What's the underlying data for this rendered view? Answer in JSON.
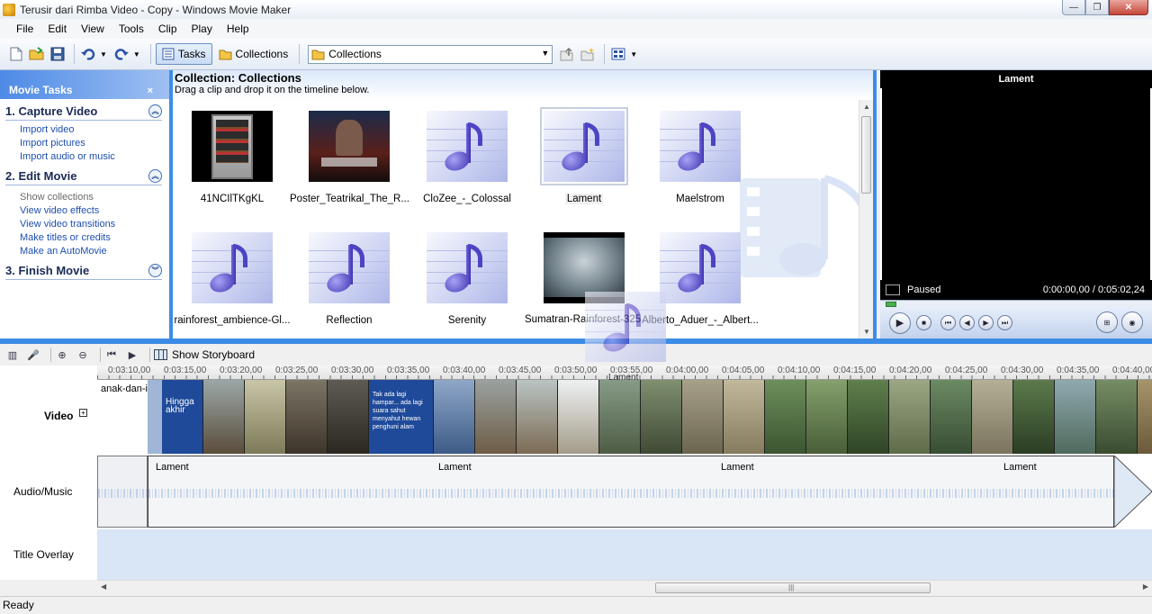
{
  "window": {
    "title": "Terusir dari Rimba Video - Copy - Windows Movie Maker",
    "min_glyph": "—",
    "max_glyph": "❐",
    "close_glyph": "✕"
  },
  "menu": [
    "File",
    "Edit",
    "View",
    "Tools",
    "Clip",
    "Play",
    "Help"
  ],
  "toolbar": {
    "tasks_label": "Tasks",
    "collections_label": "Collections",
    "collection_select_value": "Collections"
  },
  "tasks": {
    "header": "Movie Tasks",
    "close_glyph": "×",
    "sections": [
      {
        "title": "1. Capture Video",
        "toggle": "︽",
        "links": [
          "Import video",
          "Import pictures",
          "Import audio or music"
        ]
      },
      {
        "title": "2. Edit Movie",
        "toggle": "︽",
        "links": [
          "Show collections",
          "View video effects",
          "View video transitions",
          "Make titles or credits",
          "Make an AutoMovie"
        ]
      },
      {
        "title": "3. Finish Movie",
        "toggle": "︾",
        "links": []
      }
    ]
  },
  "collection": {
    "title": "Collection: Collections",
    "subtitle": "Drag a clip and drop it on the timeline below.",
    "items": [
      {
        "label": "41NCIlTKgKL",
        "kind": "image-fridge"
      },
      {
        "label": "Poster_Teatrikal_The_R...",
        "kind": "image-poster"
      },
      {
        "label": "CloZee_-_Colossal",
        "kind": "music"
      },
      {
        "label": "Lament",
        "kind": "music",
        "selected": true
      },
      {
        "label": "Maelstrom",
        "kind": "music"
      },
      {
        "label": "rainforest_ambience-Gl...",
        "kind": "music"
      },
      {
        "label": "Reflection",
        "kind": "music"
      },
      {
        "label": "Serenity",
        "kind": "music"
      },
      {
        "label": "Sumatran-Rainforest-325",
        "kind": "image-forest"
      },
      {
        "label": "Alberto_Aduer_-_Albert...",
        "kind": "music"
      }
    ]
  },
  "monitor": {
    "title": "Lament",
    "status": "Paused",
    "time": "0:00:00,00 / 0:05:02,24"
  },
  "timeline": {
    "toolbar": {
      "show_storyboard": "Show Storyboard"
    },
    "ruler_labels": [
      "0:03:10,00",
      "0:03:15,00",
      "0:03:20,00",
      "0:03:25,00",
      "0:03:30,00",
      "0:03:35,00",
      "0:03:40,00",
      "0:03:45,00",
      "0:03:50,00",
      "0:03:55,00",
      "0:04:00,00",
      "0:04:05,00",
      "0:04:10,00",
      "0:04:15,00",
      "0:04:20,00",
      "0:04:25,00",
      "0:04:30,00",
      "0:04:35,00",
      "0:04:40,00"
    ],
    "tracks": {
      "video": "Video",
      "audio": "Audio/Music",
      "overlay": "Title Overlay"
    },
    "video_clip_label": "anak-dan-i...",
    "frame_text_1": "Hingga akhir",
    "frame_text_2": "Tak ada lagi hampar... ada lagi suara sahut menyahut hewan penghuni alam",
    "audio_clip_labels": [
      "Lament",
      "Lament",
      "Lament",
      "Lament"
    ],
    "drag_tooltip": "Lament",
    "expand_glyph": "+",
    "star_glyph": "★"
  },
  "status_bar": "Ready",
  "colors": {
    "accent": "#3c8ce6",
    "task_header": "#4e8ae6",
    "link": "#1f4fb0"
  }
}
